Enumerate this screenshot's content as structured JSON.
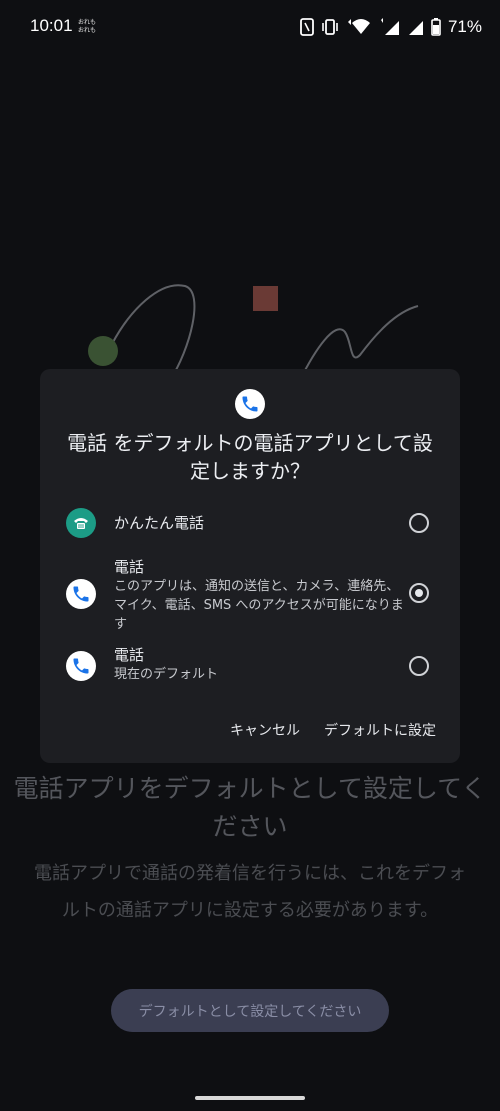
{
  "status_bar": {
    "time": "10:01",
    "notification_line1": "おれも",
    "notification_line2": "おれも",
    "battery": "71%"
  },
  "dialog": {
    "title": "電話 をデフォルトの電話アプリとして設定しますか？",
    "options": [
      {
        "title": "かんたん電話",
        "subtitle": "",
        "selected": false,
        "icon": "easy-phone-icon"
      },
      {
        "title": "電話",
        "subtitle": "このアプリは、通知の送信と、カメラ、連絡先、マイク、電話、SMS へのアクセスが可能になります",
        "selected": true,
        "icon": "phone-app-icon"
      },
      {
        "title": "電話",
        "subtitle": "現在のデフォルト",
        "selected": false,
        "icon": "phone-app-icon"
      }
    ],
    "cancel_label": "キャンセル",
    "set_default_label": "デフォルトに設定"
  },
  "page": {
    "heading": "電話アプリをデフォルトとして設定してください",
    "description": "電話アプリで通話の発着信を行うには、これをデフォルトの通話アプリに設定する必要があります。",
    "button_label": "デフォルトとして設定してください"
  },
  "colors": {
    "background": "#0e0f12",
    "dialog": "#1d1e22",
    "accent_blue": "#1a73e8",
    "easy_phone_teal": "#1c9c86"
  }
}
